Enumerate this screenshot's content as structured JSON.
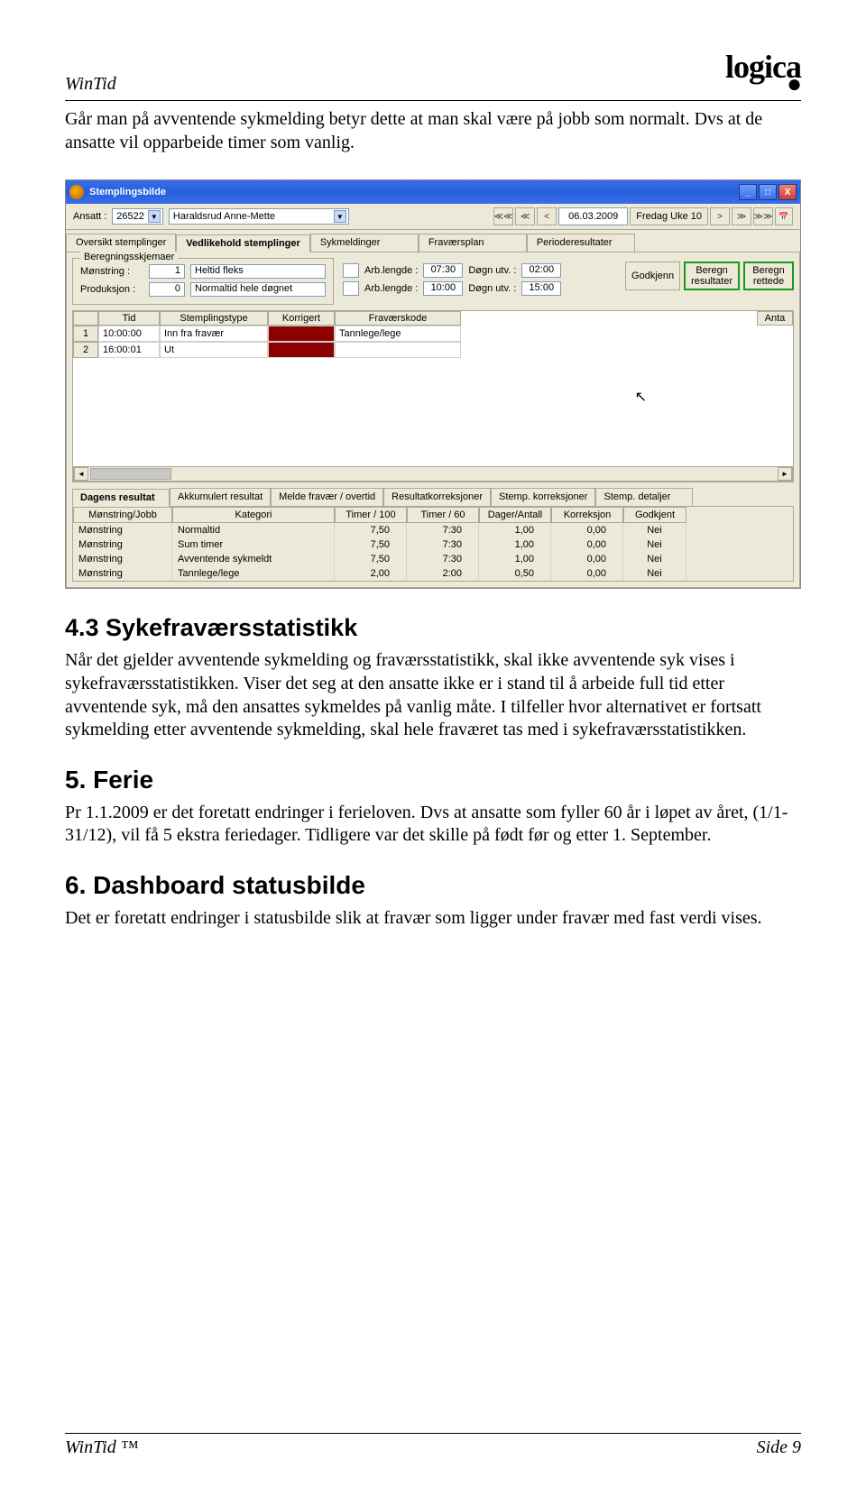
{
  "header": {
    "product": "WinTid",
    "logo": "logica"
  },
  "intro_para": "Går man på avventende sykmelding betyr dette at man skal være på jobb som normalt. Dvs at de ansatte vil opparbeide timer som vanlig.",
  "screenshot": {
    "title": "Stemplingsbilde",
    "win_min": "_",
    "win_max": "□",
    "win_close": "X",
    "ansatt_label": "Ansatt :",
    "ansatt_code": "26522",
    "ansatt_name": "Haraldsrud Anne-Mette",
    "nav": {
      "first": "≪≪",
      "fastback": "≪",
      "back": "<",
      "date": "06.03.2009",
      "week": "Fredag  Uke 10",
      "fwd": ">",
      "fastfwd": "≫",
      "last": "≫≫",
      "cal": "📅"
    },
    "tabs": [
      "Oversikt stemplinger",
      "Vedlikehold stemplinger",
      "Sykmeldinger",
      "Fraværsplan",
      "Perioderesultater"
    ],
    "active_tab": 1,
    "schema": {
      "box_title": "Beregningsskjemaer",
      "monstring_label": "Mønstring :",
      "monstring_val": "1",
      "monstring_txt": "Heltid fleks",
      "produksjon_label": "Produksjon :",
      "produksjon_val": "0",
      "produksjon_txt": "Normaltid hele døgnet",
      "arb1_label": "Arb.lengde :",
      "arb1_val": "07:30",
      "dogn1_label": "Døgn utv. :",
      "dogn1_val": "02:00",
      "arb2_label": "Arb.lengde :",
      "arb2_val": "10:00",
      "dogn2_label": "Døgn utv. :",
      "dogn2_val": "15:00",
      "btn_godkjenn": "Godkjenn",
      "btn_beregn_res": "Beregn\nresultater",
      "btn_beregn_ret": "Beregn\nrettede"
    },
    "grid_headers": [
      "",
      "Tid",
      "Stemplingstype",
      "Korrigert",
      "Fraværskode",
      "",
      "Anta"
    ],
    "grid_rows": [
      {
        "n": "1",
        "tid": "10:00:00",
        "type": "Inn fra fravær",
        "frav": "Tannlege/lege"
      },
      {
        "n": "2",
        "tid": "16:00:01",
        "type": "Ut",
        "frav": ""
      }
    ],
    "sub_tabs": [
      "Dagens resultat",
      "Akkumulert resultat",
      "Melde fravær / overtid",
      "Resultatkorreksjoner",
      "Stemp. korreksjoner",
      "Stemp. detaljer"
    ],
    "active_sub_tab": 0,
    "result_headers": [
      "Mønstring/Jobb",
      "Kategori",
      "Timer / 100",
      "Timer / 60",
      "Dager/Antall",
      "Korreksjon",
      "Godkjent"
    ],
    "result_rows": [
      {
        "cat": "Mønstring",
        "kat": "Normaltid",
        "t100": "7,50",
        "t60": "7:30",
        "dag": "1,00",
        "kor": "0,00",
        "god": "Nei"
      },
      {
        "cat": "Mønstring",
        "kat": "Sum timer",
        "t100": "7,50",
        "t60": "7:30",
        "dag": "1,00",
        "kor": "0,00",
        "god": "Nei"
      },
      {
        "cat": "Mønstring",
        "kat": "Avventende sykmeldt",
        "t100": "7,50",
        "t60": "7:30",
        "dag": "1,00",
        "kor": "0,00",
        "god": "Nei"
      },
      {
        "cat": "Mønstring",
        "kat": "Tannlege/lege",
        "t100": "2,00",
        "t60": "2:00",
        "dag": "0,50",
        "kor": "0,00",
        "god": "Nei"
      }
    ]
  },
  "sec43_title": "4.3 Sykefraværsstatistikk",
  "sec43_body": "Når det gjelder avventende sykmelding og fraværsstatistikk, skal ikke avventende syk vises i sykefraværsstatistikken. Viser det seg at den ansatte ikke er i stand til å arbeide full tid etter avventende syk, må den ansattes sykmeldes på vanlig måte. I tilfeller hvor alternativet er fortsatt sykmelding etter avventende sykmelding, skal hele fraværet tas med i sykefraværsstatistikken.",
  "sec5_title": "5. Ferie",
  "sec5_body": "Pr 1.1.2009 er det foretatt endringer i ferieloven. Dvs at ansatte som fyller 60 år i løpet av året, (1/1-31/12), vil få 5 ekstra feriedager. Tidligere var det skille på født før og etter 1. September.",
  "sec6_title": "6. Dashboard statusbilde",
  "sec6_body": "Det er foretatt endringer i statusbilde slik at fravær som ligger under fravær med fast verdi vises.",
  "footer": {
    "product": "WinTid ™",
    "page": "Side 9"
  }
}
